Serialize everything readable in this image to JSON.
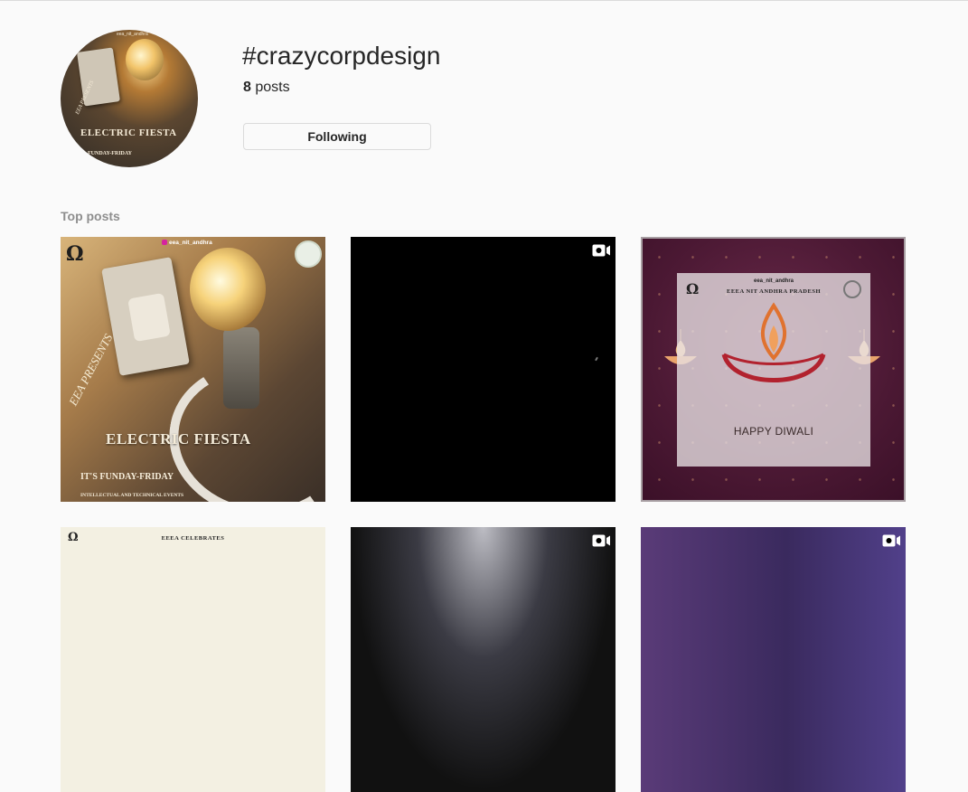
{
  "header": {
    "hashtag": "#crazycorpdesign",
    "post_count": "8",
    "post_count_suffix": " posts",
    "follow_button": "Following"
  },
  "avatar": {
    "handle": "eea_nit_andhra",
    "presents": "EEA PRESENTS",
    "headline": "ELECTRIC FIESTA",
    "sub": "FUNDAY-FRIDAY"
  },
  "top_posts": {
    "label": "Top posts",
    "items": [
      {
        "type": "image",
        "handle": "eea_nit_andhra",
        "presents": "EEA PRESENTS",
        "headline": "ELECTRIC FIESTA",
        "subtitle": "IT'S FUNDAY-FRIDAY",
        "tagline": "INTELLECTUAL AND TECHNICAL EVENTS"
      },
      {
        "type": "video",
        "icon": "video-icon"
      },
      {
        "type": "image",
        "handle": "eea_nit_andhra",
        "org": "EEEA NIT ANDHRA PRADESH",
        "greeting": "HAPPY DIWALI"
      },
      {
        "type": "image",
        "text": "EEEA CELEBRATES"
      },
      {
        "type": "video",
        "icon": "video-icon"
      },
      {
        "type": "video",
        "icon": "video-icon"
      }
    ]
  },
  "colors": {
    "background": "#fafafa",
    "text": "#262626",
    "muted": "#8e8e8e",
    "border": "#dbdbdb"
  }
}
